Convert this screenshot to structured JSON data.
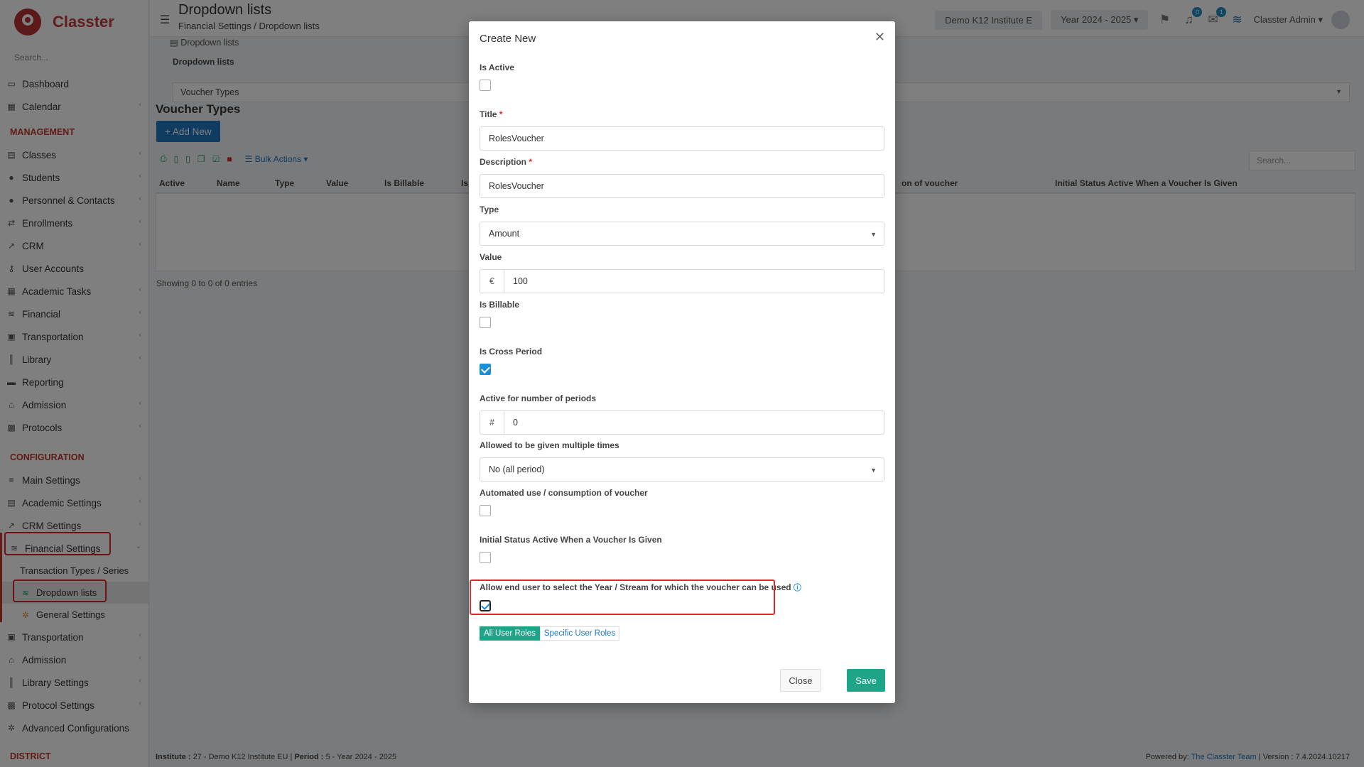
{
  "sidebar": {
    "logo_text": "Classter",
    "search_placeholder": "Search...",
    "items": [
      {
        "label": "Dashboard",
        "icon": "monitor-icon"
      },
      {
        "label": "Calendar",
        "icon": "calendar-icon"
      }
    ],
    "management_title": "MANAGEMENT",
    "management": [
      {
        "label": "Classes"
      },
      {
        "label": "Students"
      },
      {
        "label": "Personnel & Contacts"
      },
      {
        "label": "Enrollments"
      },
      {
        "label": "CRM"
      },
      {
        "label": "User Accounts"
      },
      {
        "label": "Academic Tasks"
      },
      {
        "label": "Financial"
      },
      {
        "label": "Transportation"
      },
      {
        "label": "Library"
      },
      {
        "label": "Reporting"
      },
      {
        "label": "Admission"
      },
      {
        "label": "Protocols"
      }
    ],
    "configuration_title": "CONFIGURATION",
    "configuration": [
      {
        "label": "Main Settings"
      },
      {
        "label": "Academic Settings"
      },
      {
        "label": "CRM Settings"
      },
      {
        "label": "Financial Settings"
      }
    ],
    "financial_sub": [
      {
        "label": "Transaction Types / Series"
      },
      {
        "label": "Dropdown lists"
      },
      {
        "label": "General Settings"
      }
    ],
    "configuration_rest": [
      {
        "label": "Transportation"
      },
      {
        "label": "Admission"
      },
      {
        "label": "Library Settings"
      },
      {
        "label": "Protocol Settings"
      },
      {
        "label": "Advanced Configurations"
      }
    ],
    "district_title": "DISTRICT"
  },
  "header": {
    "title": "Dropdown lists",
    "breadcrumb": [
      "Financial Settings",
      "Dropdown lists"
    ],
    "institute": "Demo K12 Institute E",
    "year": "Year 2024 - 2025",
    "notif_count": "0",
    "msg_count": "1",
    "user": "Classter Admin"
  },
  "main": {
    "sub_breadcrumb": "Dropdown lists",
    "panel_label": "Dropdown lists",
    "selected_list": "Voucher Types",
    "section_title": "Voucher Types",
    "add_new": "Add New",
    "bulk_actions": "Bulk Actions",
    "search_placeholder": "Search...",
    "columns": [
      "Active",
      "Name",
      "Type",
      "Value",
      "Is Billable",
      "Is",
      "on of voucher",
      "Initial Status Active When a Voucher Is Given"
    ],
    "entries": "Showing 0 to 0 of 0 entries"
  },
  "footer": {
    "left_label1": "Institute :",
    "left_value1": "27 - Demo K12 Institute EU",
    "left_label2": "Period :",
    "left_value2": "5 - Year 2024 - 2025",
    "powered": "Powered by:",
    "team": "The Classter Team",
    "version": "Version : 7.4.2024.10217"
  },
  "modal": {
    "title": "Create New",
    "is_active_label": "Is Active",
    "title_label": "Title",
    "title_value": "RolesVoucher",
    "description_label": "Description",
    "description_value": "RolesVoucher",
    "type_label": "Type",
    "type_value": "Amount",
    "value_label": "Value",
    "value_addon": "€",
    "value_value": "100",
    "is_billable_label": "Is Billable",
    "cross_period_label": "Is Cross Period",
    "periods_label": "Active for number of periods",
    "periods_addon": "#",
    "periods_value": "0",
    "multiple_label": "Allowed to be given multiple times",
    "multiple_value": "No (all period)",
    "automated_label": "Automated use / consumption of voucher",
    "initial_status_label": "Initial Status Active When a Voucher Is Given",
    "allow_year_label": "Allow end user to select the Year / Stream for which the voucher can be used",
    "role_all": "All User Roles",
    "role_specific": "Specific User Roles",
    "close": "Close",
    "save": "Save"
  }
}
